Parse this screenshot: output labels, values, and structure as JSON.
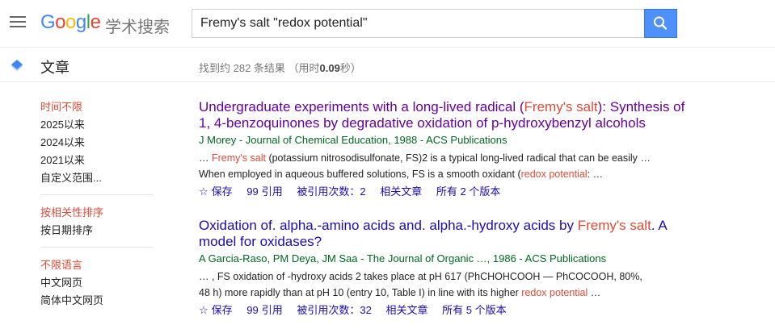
{
  "header": {
    "logo_letters": [
      "G",
      "o",
      "o",
      "g",
      "l",
      "e"
    ],
    "logo_sub": "学术搜索",
    "search_value": "Fremy's salt \"redox potential\""
  },
  "subheader": {
    "category": "文章",
    "stats_prefix": "找到约 282 条结果  （用时",
    "stats_time": "0.09",
    "stats_suffix": "秒）"
  },
  "sidebar": {
    "time_group": [
      "时间不限",
      "2025以来",
      "2024以来",
      "2021以来",
      "自定义范围..."
    ],
    "sort_group": [
      "按相关性排序",
      "按日期排序"
    ],
    "lang_group": [
      "不限语言",
      "中文网页",
      "简体中文网页"
    ]
  },
  "results": [
    {
      "title_1": "Undergraduate experiments with a long-lived radical (",
      "title_hl": "Fremy's salt",
      "title_2": "): Synthesis of 1, 4-benzoquinones by degradative oxidation of p-hydroxybenzyl alcohols",
      "meta": "J Morey - Journal of Chemical Education, 1988 - ACS Publications",
      "snip_1": "… ",
      "snip_hl1": "Fremy's salt",
      "snip_2": " (potassium nitrosodisulfonate, FS)2 is a typical long-lived radical that can be easily … When employed in aqueous buffered solutions, FS is a smooth oxidant (",
      "snip_hl2": "redox potential",
      "snip_3": ": …",
      "links": [
        "保存",
        "引用",
        "被引用次数：2",
        "相关文章",
        "所有 2 个版本"
      ]
    },
    {
      "title_1": "Oxidation of. alpha.-amino acids and. alpha.-hydroxy acids by ",
      "title_hl": "Fremy's salt",
      "title_2": ". A model for oxidases?",
      "meta": "A Garcia-Raso, PM Deya, JM Saa - The Journal of Organic …, 1986 - ACS Publications",
      "snip_1": "… , FS oxidation of -hydroxy acids 2 takes place at pH 617 (PhCHOHCOOH — PhCOCOOH, 80%, 48 h) more rapidly than at pH 10 (entry 10, Table I) in line with its higher ",
      "snip_hl1": "redox potential",
      "snip_2": " …",
      "links": [
        "保存",
        "引用",
        "被引用次数：32",
        "相关文章",
        "所有 5 个版本"
      ]
    }
  ]
}
